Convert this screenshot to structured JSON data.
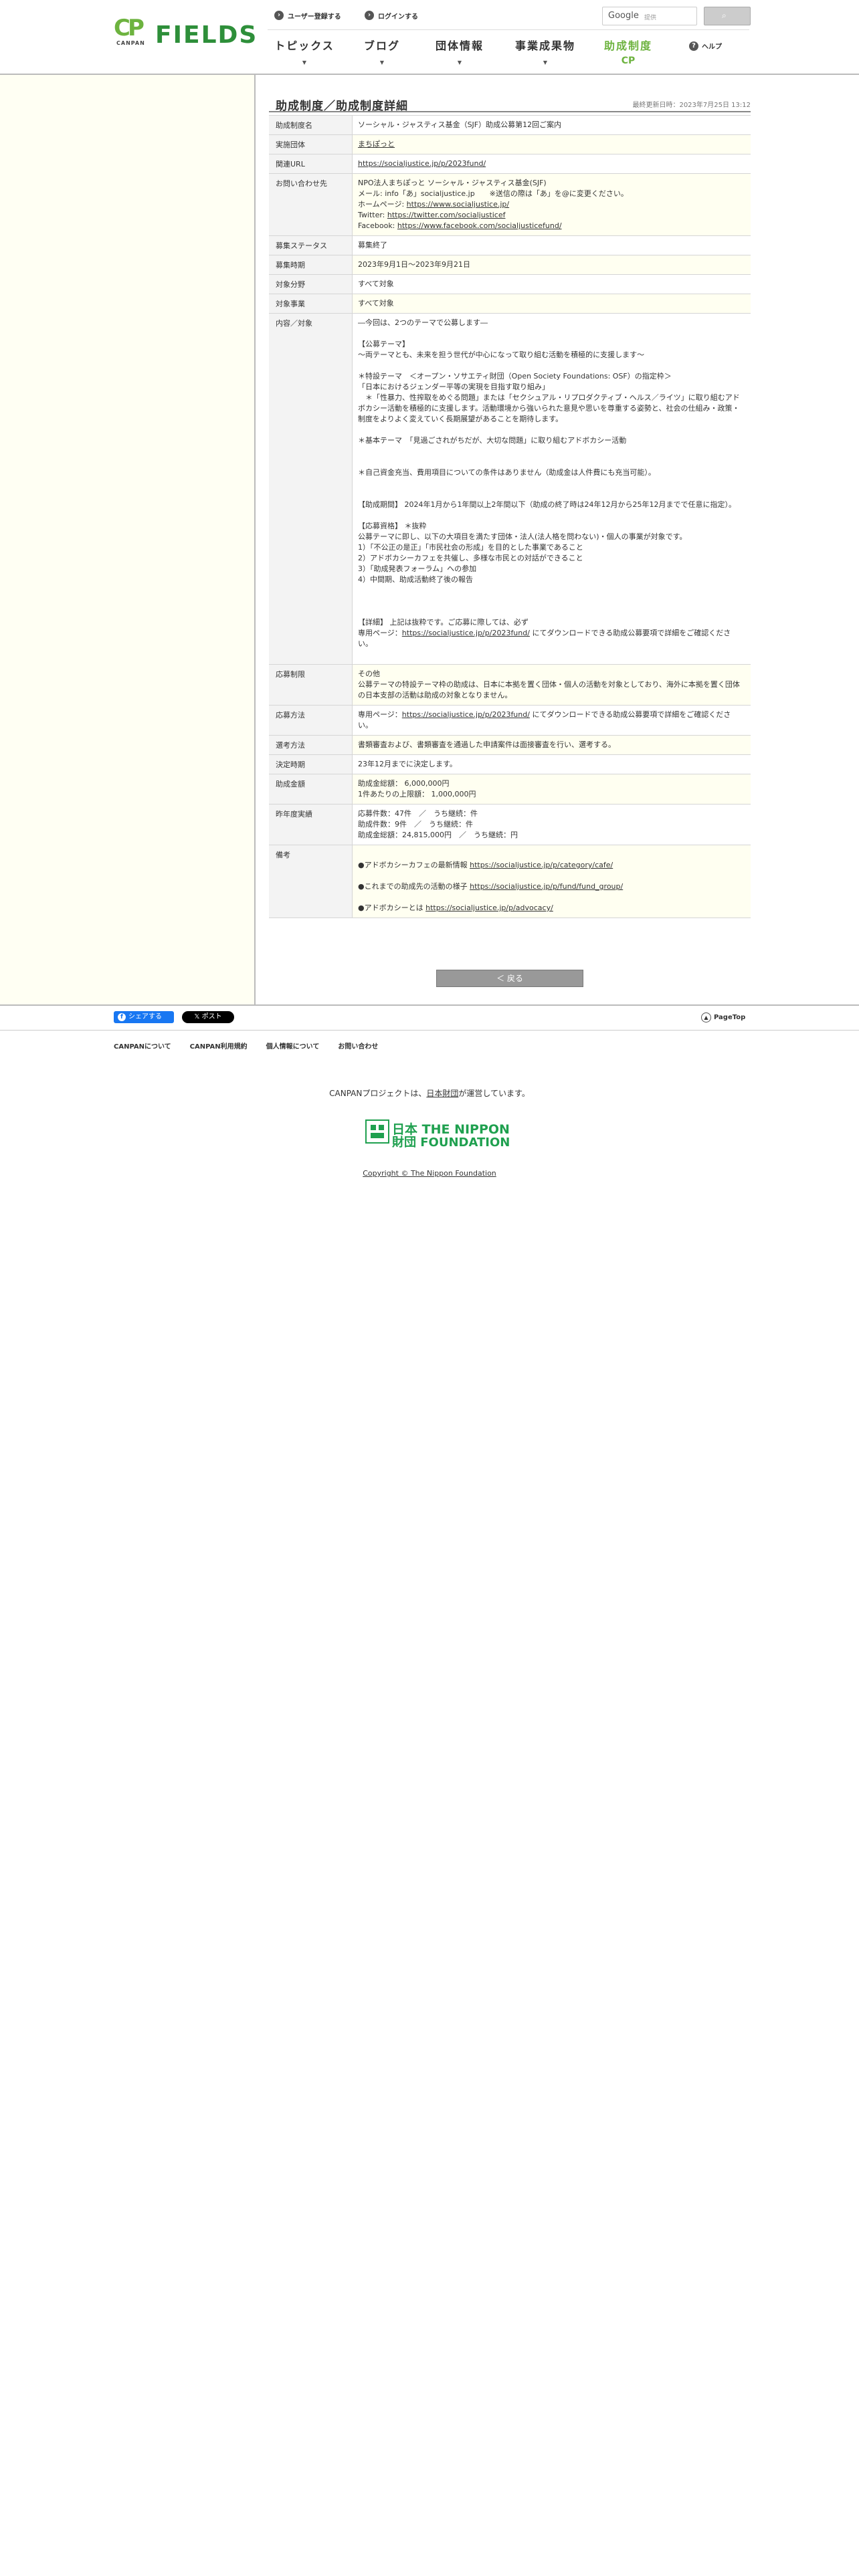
{
  "header": {
    "logo_prefix": "CANPAN",
    "logo_name": "FIELDS",
    "register_label": "ユーザー登録する",
    "login_label": "ログインする",
    "search_brand": "Google",
    "search_placeholder": "提供",
    "nav": {
      "topics": "トピックス",
      "blog": "ブログ",
      "org": "団体情報",
      "results": "事業成果物",
      "grants": "助成制度",
      "help": "ヘルプ"
    }
  },
  "page": {
    "title": "助成制度／助成制度詳細",
    "updated": "最終更新日時：2023年7月25日 13:12"
  },
  "detail": {
    "program_name": {
      "label": "助成制度名",
      "value": "ソーシャル・ジャスティス基金（SJF）助成公募第12回ご案内"
    },
    "org": {
      "label": "実施団体",
      "value": "まちぽっと"
    },
    "url": {
      "label": "関連URL",
      "value": "https://socialjustice.jp/p/2023fund/"
    },
    "contact": {
      "label": "お問い合わせ先",
      "line1": "NPO法人まちぽっと ソーシャル・ジャスティス基金(SJF)",
      "line2": "メール: info「あ」socialjustice.jp　　※送信の際は「あ」を@に変更ください。",
      "homepage_prefix": "ホームページ: ",
      "homepage": "https://www.socialjustice.jp/",
      "twitter_prefix": "Twitter: ",
      "twitter": "https://twitter.com/socialjusticef",
      "facebook_prefix": "Facebook: ",
      "facebook": "https://www.facebook.com/socialjusticefund/"
    },
    "status": {
      "label": "募集ステータス",
      "value": "募集終了"
    },
    "period": {
      "label": "募集時期",
      "value": "2023年9月1日～2023年9月21日"
    },
    "field": {
      "label": "対象分野",
      "value": "すべて対象"
    },
    "project": {
      "label": "対象事業",
      "value": "すべて対象"
    },
    "content": {
      "label": "内容／対象",
      "p1": "―今回は、2つのテーマで公募します―",
      "p2": "【公募テーマ】\n～両テーマとも、未来を担う世代が中心になって取り組む活動を積極的に支援します～",
      "p3": "＊特設テーマ　＜オープン・ソサエティ財団（Open Society Foundations: OSF）の指定枠＞\n「日本におけるジェンダー平等の実現を目指す取り組み」\n　＊「性暴力、性搾取をめぐる問題」または「セクシュアル・リプロダクティブ・ヘルス／ライツ」に取り組むアドボカシー活動を積極的に支援します。活動環境から強いられた意見や思いを尊重する姿勢と、社会の仕組み・政策・制度をよりよく変えていく長期展望があることを期待します。",
      "p4": "＊基本テーマ　「見過ごされがちだが、大切な問題」に取り組むアドボカシー活動",
      "p5": "＊自己資金充当、費用項目についての条件はありません（助成金は人件費にも充当可能）。",
      "p6": "【助成期間】 2024年1月から1年間以上2年間以下（助成の終了時は24年12月から25年12月までで任意に指定）。",
      "p7": "【応募資格】 ＊抜粋\n公募テーマに即し、以下の大項目を満たす団体・法人(法人格を問わない)・個人の事業が対象です。\n1）「不公正の是正」「市民社会の形成」を目的とした事業であること\n2）アドボカシーカフェを共催し、多様な市民との対話ができること\n3）「助成発表フォーラム」への参加\n4）中間期、助成活動終了後の報告",
      "p8_prefix": "【詳細】 上記は抜粋です。ご応募に際しては、必ず\n専用ページ：",
      "p8_link": "https://socialjustice.jp/p/2023fund/",
      "p8_suffix": " にてダウンロードできる助成公募要項で詳細をご確認ください。"
    },
    "limits": {
      "label": "応募制限",
      "value": "その他\n公募テーマの特設テーマ枠の助成は、日本に本拠を置く団体・個人の活動を対象としており、海外に本拠を置く団体の日本支部の活動は助成の対象となりません。"
    },
    "method": {
      "label": "応募方法",
      "prefix": "専用ページ：",
      "link": "https://socialjustice.jp/p/2023fund/",
      "suffix": " にてダウンロードできる助成公募要項で詳細をご確認ください。"
    },
    "selection": {
      "label": "選考方法",
      "value": "書類審査および、書類審査を通過した申請案件は面接審査を行い、選考する。"
    },
    "decision": {
      "label": "決定時期",
      "value": "23年12月までに決定します。"
    },
    "amount": {
      "label": "助成金額",
      "value": "助成金総額： 6,000,000円\n1件あたりの上限額： 1,000,000円"
    },
    "past": {
      "label": "昨年度実績",
      "value": "応募件数：47件　／　うち継続：件\n助成件数：9件　／　うち継続：件\n助成金総額：24,815,000円　／　うち継続：円"
    },
    "notes": {
      "label": "備考",
      "n1_prefix": "●アドボカシーカフェの最新情報 ",
      "n1_link": "https://socialjustice.jp/p/category/cafe/",
      "n2_prefix": "●これまでの助成先の活動の様子 ",
      "n2_link": "https://socialjustice.jp/p/fund/fund_group/",
      "n3_prefix": "●アドボカシーとは ",
      "n3_link": "https://socialjustice.jp/p/advocacy/"
    }
  },
  "back_button": "＜ 戻る",
  "footer": {
    "share_fb": "シェアする",
    "share_x": "𝕏 ポスト",
    "pagetop": "PageTop",
    "links": [
      "CANPANについて",
      "CANPAN利用規約",
      "個人情報について",
      "お問い合わせ"
    ],
    "operated_prefix": "CANPANプロジェクトは、",
    "operated_link": "日本財団",
    "operated_suffix": "が運営しています。",
    "nf_line1": "日本 THE NIPPON",
    "nf_line2": "財団 FOUNDATION",
    "copyright": "Copyright © The Nippon Foundation"
  },
  "colors": {
    "brand_green": "#6db33f",
    "nf_green": "#1fa04f",
    "side_bg": "#fffff3",
    "fb_blue": "#1877f2"
  }
}
